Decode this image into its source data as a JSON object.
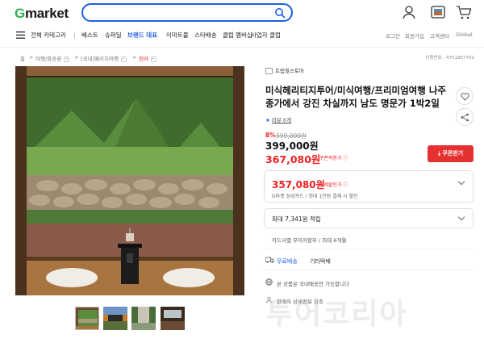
{
  "header": {
    "logo_g": "G",
    "logo_rest": "market",
    "search_placeholder": "",
    "icons": [
      "search-icon",
      "user-icon",
      "recent-view-icon",
      "cart-icon"
    ]
  },
  "nav": {
    "all_categories": "전체 카테고리",
    "items": [
      "베스트",
      "슈퍼딜",
      "브랜드 대표",
      "이마트몰",
      "스타배송",
      "클럽 멤버십",
      "사업자 클럽"
    ],
    "right": [
      "로그인",
      "회원가입",
      "고객센터",
      "Global"
    ]
  },
  "breadcrumb": {
    "home": "홈",
    "level1": "여행/항공권",
    "level2": "[국내]패키지여행",
    "level3": "전라",
    "product_no": "상품번호 : 4751857792"
  },
  "product": {
    "store": "트립웟스토어",
    "title": "미식헤리티지투어/미식여행/프리미엄여행 나주 종가에서 강진 차실까지 남도 명문가 1박2일",
    "review": "리뷰 0개",
    "discount_pct": "8%",
    "original_price": "399,000원",
    "price": "399,000원",
    "coupon_price": "367,080원",
    "coupon_price_label": "쿠폰적용가 ⓘ",
    "coupon_button": "쿠폰받기",
    "card_price": "357,080원",
    "card_price_label": "결제할인가 ⓘ",
    "card_discount_desc": "G마켓 삼성카드 / 최대 1만원 결제 시 할인",
    "points": "최대 7,341원 적립",
    "card_info": "카드사별 무이자할부 / 최대 6개월",
    "shipping_free": "무료배송",
    "shipping_other": "기타택배",
    "domestic_only": "본 상품은 국내배송만 가능합니다",
    "inquiry": "판매자 상세정보 참조",
    "watermark": "투어코리아"
  },
  "colors": {
    "brand_green": "#2bb24c",
    "accent_blue": "#1e5eea",
    "price_red": "#e22"
  }
}
